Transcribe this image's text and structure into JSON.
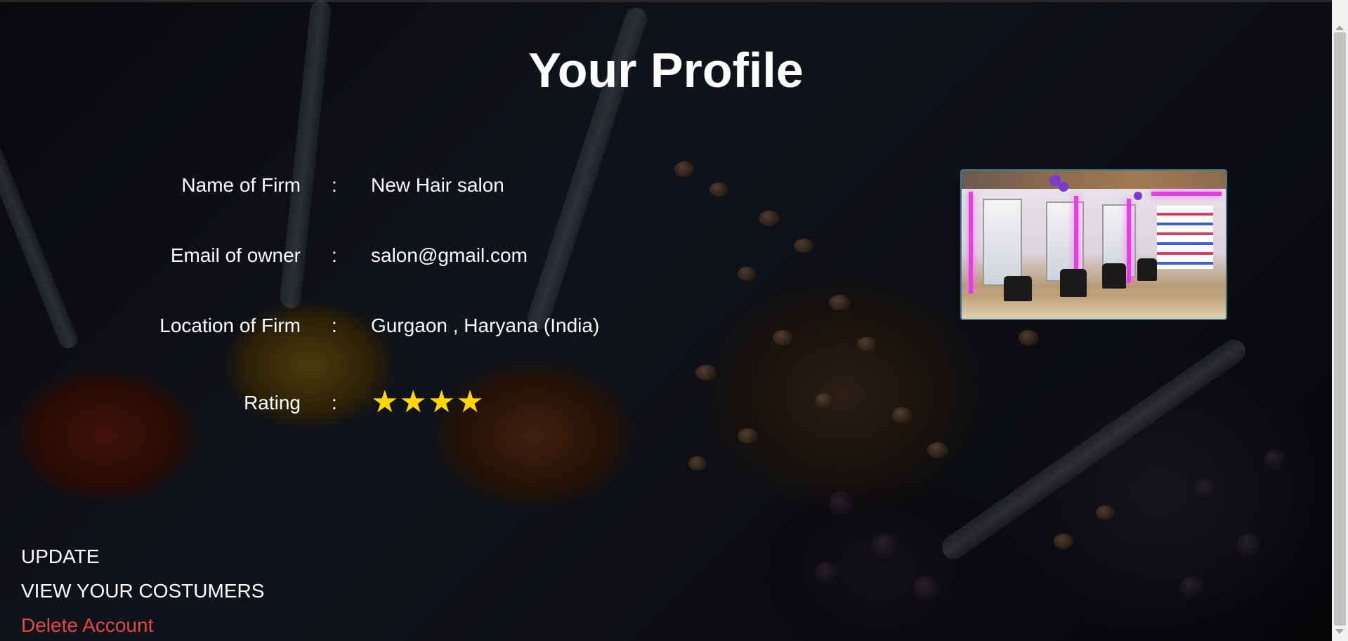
{
  "page": {
    "title": "Your Profile"
  },
  "profile": {
    "fields": [
      {
        "label": "Name of Firm",
        "separator": ":",
        "value": "New Hair salon"
      },
      {
        "label": "Email of owner",
        "separator": ":",
        "value": "salon@gmail.com"
      },
      {
        "label": "Location of Firm",
        "separator": ":",
        "value": "Gurgaon , Haryana (India)"
      }
    ],
    "rating": {
      "label": "Rating",
      "separator": ":",
      "stars": 4,
      "star_glyph": "★",
      "star_color": "#ffd700"
    }
  },
  "actions": {
    "update": "UPDATE",
    "view_customers": "VIEW YOUR COSTUMERS",
    "delete_account": "Delete Account",
    "delete_color": "#e04848"
  },
  "photo": {
    "icon": "salon-photo"
  }
}
